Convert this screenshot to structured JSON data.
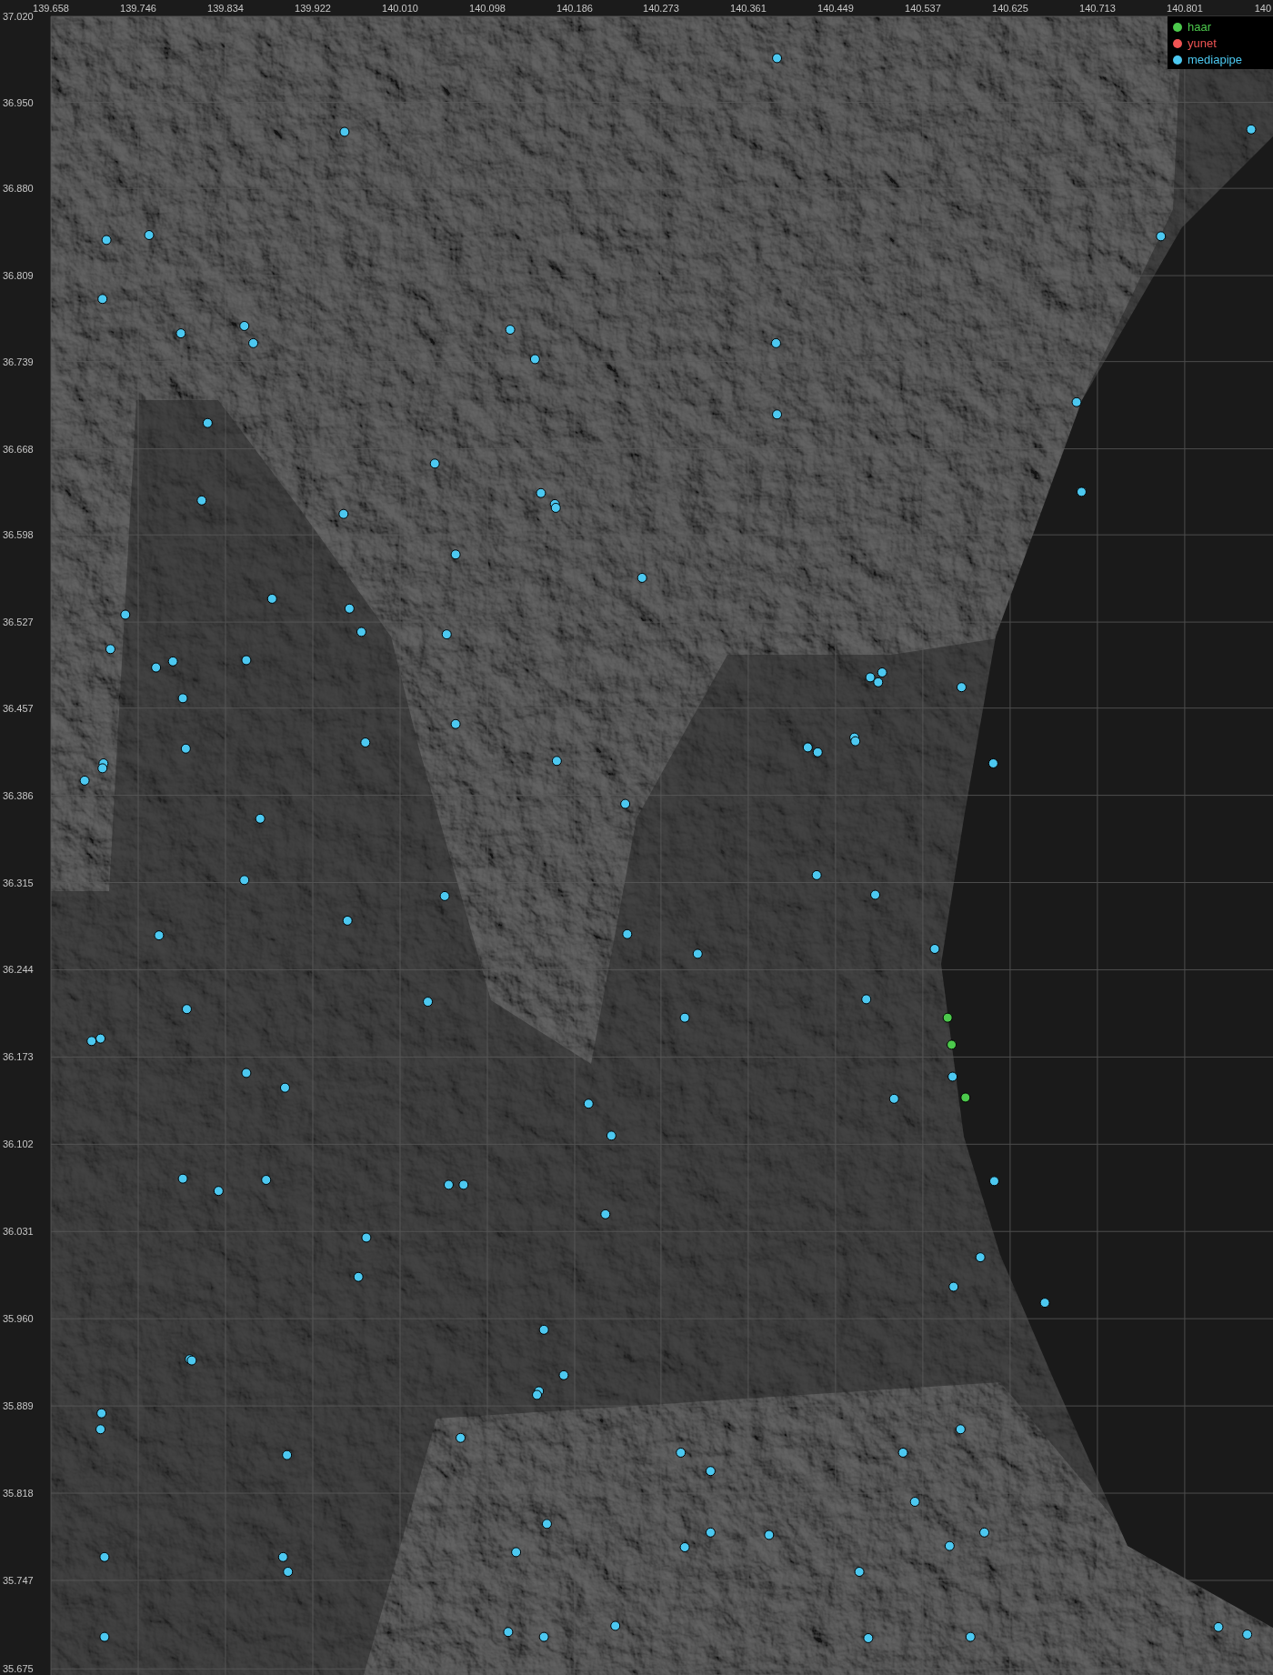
{
  "map": {
    "x_cut_label": "140",
    "chart_data": {
      "type": "scatter",
      "xlim": [
        139.658,
        140.89
      ],
      "ylim": [
        35.67,
        37.02
      ],
      "grid": true,
      "xticks": [
        {
          "value": 139.658,
          "label": "139.658"
        },
        {
          "value": 139.746,
          "label": "139.746"
        },
        {
          "value": 139.834,
          "label": "139.834"
        },
        {
          "value": 139.922,
          "label": "139.922"
        },
        {
          "value": 140.01,
          "label": "140.010"
        },
        {
          "value": 140.098,
          "label": "140.098"
        },
        {
          "value": 140.186,
          "label": "140.186"
        },
        {
          "value": 140.273,
          "label": "140.273"
        },
        {
          "value": 140.361,
          "label": "140.361"
        },
        {
          "value": 140.449,
          "label": "140.449"
        },
        {
          "value": 140.537,
          "label": "140.537"
        },
        {
          "value": 140.625,
          "label": "140.625"
        },
        {
          "value": 140.713,
          "label": "140.713"
        },
        {
          "value": 140.801,
          "label": "140.801"
        }
      ],
      "yticks": [
        {
          "value": 37.02,
          "label": "37.020"
        },
        {
          "value": 36.95,
          "label": "36.950"
        },
        {
          "value": 36.88,
          "label": "36.880"
        },
        {
          "value": 36.809,
          "label": "36.809"
        },
        {
          "value": 36.739,
          "label": "36.739"
        },
        {
          "value": 36.668,
          "label": "36.668"
        },
        {
          "value": 36.598,
          "label": "36.598"
        },
        {
          "value": 36.527,
          "label": "36.527"
        },
        {
          "value": 36.457,
          "label": "36.457"
        },
        {
          "value": 36.386,
          "label": "36.386"
        },
        {
          "value": 36.315,
          "label": "36.315"
        },
        {
          "value": 36.244,
          "label": "36.244"
        },
        {
          "value": 36.173,
          "label": "36.173"
        },
        {
          "value": 36.102,
          "label": "36.102"
        },
        {
          "value": 36.031,
          "label": "36.031"
        },
        {
          "value": 35.96,
          "label": "35.960"
        },
        {
          "value": 35.889,
          "label": "35.889"
        },
        {
          "value": 35.818,
          "label": "35.818"
        },
        {
          "value": 35.747,
          "label": "35.747"
        },
        {
          "value": 35.675,
          "label": "35.675"
        }
      ],
      "series": [
        {
          "name": "haar",
          "color": "#4cc94c",
          "x": [
            140.562,
            140.566,
            140.58
          ],
          "values": [
            36.205,
            36.183,
            36.14
          ]
        },
        {
          "name": "yunet",
          "color": "#f05454"
        },
        {
          "name": "mediapipe",
          "color": "#4cc8f0",
          "x": [
            140.39,
            139.954,
            140.868,
            139.714,
            139.757,
            140.777,
            139.71,
            139.789,
            139.853,
            139.862,
            140.121,
            140.146,
            140.389,
            140.692,
            140.39,
            139.816,
            140.045,
            140.152,
            140.166,
            140.167,
            139.81,
            139.953,
            140.697,
            140.066,
            140.254,
            139.881,
            139.733,
            139.959,
            139.971,
            140.057,
            139.718,
            139.764,
            139.781,
            139.855,
            139.791,
            140.484,
            140.496,
            140.492,
            140.576,
            140.066,
            139.975,
            140.468,
            140.469,
            140.421,
            140.431,
            139.794,
            139.711,
            139.71,
            139.692,
            140.168,
            140.608,
            140.237,
            139.869,
            140.43,
            139.853,
            140.055,
            140.489,
            139.767,
            139.957,
            140.239,
            140.31,
            140.549,
            140.038,
            140.48,
            139.795,
            140.297,
            139.708,
            139.699,
            139.855,
            139.894,
            140.2,
            140.567,
            140.508,
            140.223,
            139.791,
            139.827,
            139.875,
            140.059,
            140.074,
            140.609,
            140.217,
            139.976,
            140.595,
            139.968,
            140.568,
            140.66,
            140.155,
            139.798,
            139.8,
            140.175,
            140.15,
            140.148,
            139.709,
            139.708,
            140.071,
            139.896,
            140.293,
            140.575,
            140.517,
            140.323,
            140.529,
            140.158,
            140.599,
            140.323,
            140.382,
            140.297,
            140.564,
            140.127,
            139.712,
            139.892,
            139.897,
            140.473,
            140.119,
            140.155,
            140.227,
            139.712,
            140.482,
            140.585,
            140.835,
            140.864
          ],
          "values": [
            36.986,
            36.926,
            36.928,
            36.838,
            36.842,
            36.841,
            36.79,
            36.762,
            36.768,
            36.754,
            36.765,
            36.741,
            36.754,
            36.706,
            36.696,
            36.689,
            36.656,
            36.632,
            36.623,
            36.62,
            36.626,
            36.615,
            36.633,
            36.582,
            36.563,
            36.546,
            36.533,
            36.538,
            36.519,
            36.517,
            36.505,
            36.49,
            36.495,
            36.496,
            36.465,
            36.482,
            36.486,
            36.478,
            36.474,
            36.444,
            36.429,
            36.433,
            36.43,
            36.425,
            36.421,
            36.424,
            36.412,
            36.408,
            36.398,
            36.414,
            36.412,
            36.379,
            36.367,
            36.321,
            36.317,
            36.304,
            36.305,
            36.272,
            36.284,
            36.273,
            36.257,
            36.261,
            36.218,
            36.22,
            36.212,
            36.205,
            36.188,
            36.186,
            36.16,
            36.148,
            36.135,
            36.157,
            36.139,
            36.109,
            36.074,
            36.064,
            36.073,
            36.069,
            36.069,
            36.072,
            36.045,
            36.026,
            36.01,
            35.994,
            35.986,
            35.973,
            35.951,
            35.927,
            35.926,
            35.914,
            35.901,
            35.898,
            35.883,
            35.87,
            35.863,
            35.849,
            35.851,
            35.87,
            35.851,
            35.836,
            35.811,
            35.793,
            35.786,
            35.786,
            35.784,
            35.774,
            35.775,
            35.77,
            35.766,
            35.766,
            35.754,
            35.754,
            35.705,
            35.701,
            35.71,
            35.701,
            35.7,
            35.701,
            35.709,
            35.703
          ]
        }
      ]
    }
  }
}
